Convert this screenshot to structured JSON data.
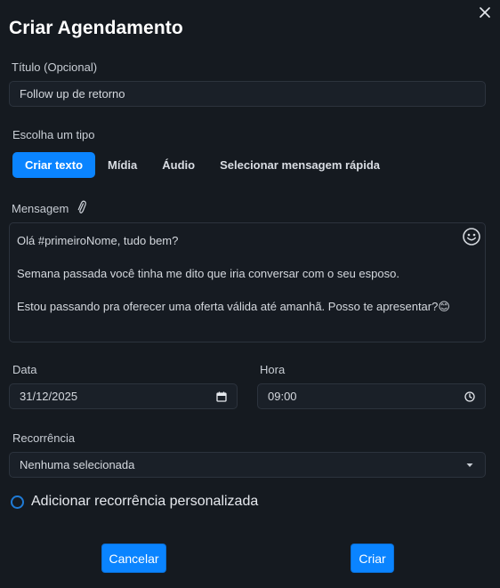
{
  "dialog": {
    "title": "Criar Agendamento"
  },
  "title_field": {
    "label": "Título (Opcional)",
    "value": "Follow up de retorno"
  },
  "type_section": {
    "label": "Escolha um tipo",
    "tabs": [
      {
        "label": "Criar texto",
        "active": true
      },
      {
        "label": "Mídia",
        "active": false
      },
      {
        "label": "Áudio",
        "active": false
      },
      {
        "label": "Selecionar mensagem rápida",
        "active": false
      }
    ]
  },
  "message": {
    "label": "Mensagem",
    "lines": [
      "Olá #primeiroNome, tudo bem?",
      "Semana passada você tinha me dito que iria conversar com o seu esposo.",
      "Estou passando pra oferecer uma oferta válida até amanhã. Posso te apresentar?😊"
    ]
  },
  "date_field": {
    "label": "Data",
    "value": "31/12/2025"
  },
  "time_field": {
    "label": "Hora",
    "value": "09:00"
  },
  "recurrence": {
    "label": "Recorrência",
    "selected": "Nenhuma selecionada"
  },
  "custom_recurrence": {
    "label": "Adicionar recorrência personalizada"
  },
  "buttons": {
    "cancel": "Cancelar",
    "create": "Criar"
  },
  "colors": {
    "accent": "#0a84ff",
    "background": "#151a20",
    "input_bg": "#1a2028",
    "border": "#2c333d"
  },
  "icons": [
    "close-icon",
    "attachment-icon",
    "emoji-icon",
    "calendar-icon",
    "clock-icon",
    "chevron-down-icon"
  ]
}
